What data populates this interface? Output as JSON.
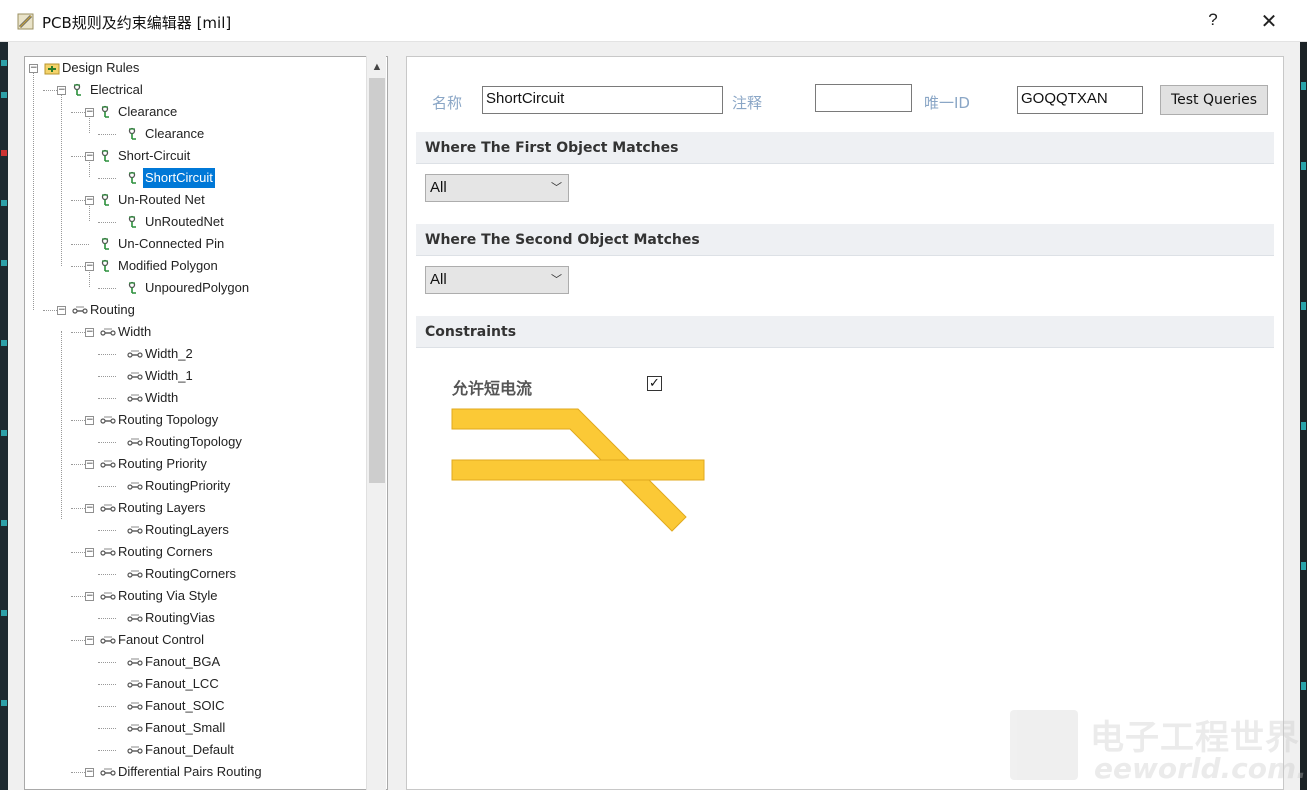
{
  "window": {
    "title": "PCB规则及约束编辑器 [mil]",
    "help_glyph": "?",
    "close_glyph": "✕"
  },
  "tree": {
    "scroll_up_glyph": "▲",
    "nodes": [
      {
        "label": "Design Rules",
        "expander": "−",
        "icon": "design-rules-folder-icon"
      },
      {
        "label": "Electrical",
        "expander": "−",
        "icon": "electrical-rule-icon"
      },
      {
        "label": "Clearance",
        "expander": "−",
        "icon": "electrical-rule-icon"
      },
      {
        "label": "Clearance",
        "expander": "",
        "icon": "electrical-rule-icon"
      },
      {
        "label": "Short-Circuit",
        "expander": "−",
        "icon": "electrical-rule-icon"
      },
      {
        "label": "ShortCircuit",
        "expander": "",
        "icon": "electrical-rule-icon",
        "selected": true
      },
      {
        "label": "Un-Routed Net",
        "expander": "−",
        "icon": "electrical-rule-icon"
      },
      {
        "label": "UnRoutedNet",
        "expander": "",
        "icon": "electrical-rule-icon"
      },
      {
        "label": "Un-Connected Pin",
        "expander": "",
        "icon": "electrical-rule-icon"
      },
      {
        "label": "Modified Polygon",
        "expander": "−",
        "icon": "electrical-rule-icon"
      },
      {
        "label": "UnpouredPolygon",
        "expander": "",
        "icon": "electrical-rule-icon"
      },
      {
        "label": "Routing",
        "expander": "−",
        "icon": "routing-rule-icon"
      },
      {
        "label": "Width",
        "expander": "−",
        "icon": "routing-rule-icon"
      },
      {
        "label": "Width_2",
        "expander": "",
        "icon": "routing-rule-icon"
      },
      {
        "label": "Width_1",
        "expander": "",
        "icon": "routing-rule-icon"
      },
      {
        "label": "Width",
        "expander": "",
        "icon": "routing-rule-icon"
      },
      {
        "label": "Routing Topology",
        "expander": "−",
        "icon": "routing-rule-icon"
      },
      {
        "label": "RoutingTopology",
        "expander": "",
        "icon": "routing-rule-icon"
      },
      {
        "label": "Routing Priority",
        "expander": "−",
        "icon": "routing-rule-icon"
      },
      {
        "label": "RoutingPriority",
        "expander": "",
        "icon": "routing-rule-icon"
      },
      {
        "label": "Routing Layers",
        "expander": "−",
        "icon": "routing-rule-icon"
      },
      {
        "label": "RoutingLayers",
        "expander": "",
        "icon": "routing-rule-icon"
      },
      {
        "label": "Routing Corners",
        "expander": "−",
        "icon": "routing-rule-icon"
      },
      {
        "label": "RoutingCorners",
        "expander": "",
        "icon": "routing-rule-icon"
      },
      {
        "label": "Routing Via Style",
        "expander": "−",
        "icon": "routing-rule-icon"
      },
      {
        "label": "RoutingVias",
        "expander": "",
        "icon": "routing-rule-icon"
      },
      {
        "label": "Fanout Control",
        "expander": "−",
        "icon": "routing-rule-icon"
      },
      {
        "label": "Fanout_BGA",
        "expander": "",
        "icon": "routing-rule-icon"
      },
      {
        "label": "Fanout_LCC",
        "expander": "",
        "icon": "routing-rule-icon"
      },
      {
        "label": "Fanout_SOIC",
        "expander": "",
        "icon": "routing-rule-icon"
      },
      {
        "label": "Fanout_Small",
        "expander": "",
        "icon": "routing-rule-icon"
      },
      {
        "label": "Fanout_Default",
        "expander": "",
        "icon": "routing-rule-icon"
      },
      {
        "label": "Differential Pairs Routing",
        "expander": "−",
        "icon": "routing-rule-icon"
      }
    ]
  },
  "rule": {
    "name_label": "名称",
    "name_value": "ShortCircuit",
    "comment_label": "注释",
    "comment_value": "",
    "uid_label": "唯一ID",
    "uid_value": "GOQQTXAN",
    "test_queries_label": "Test Queries"
  },
  "first_object": {
    "heading": "Where The First Object Matches",
    "selected": "All",
    "chevron": "﹀"
  },
  "second_object": {
    "heading": "Where The Second Object Matches",
    "selected": "All",
    "chevron": "﹀"
  },
  "constraints": {
    "heading": "Constraints",
    "allow_short_label": "允许短电流",
    "allow_short_checked": true,
    "check_glyph": "✓"
  },
  "watermark": {
    "cn": "电子工程世界",
    "en": "eeworld.com.cn"
  },
  "colors": {
    "selection": "#0078d7",
    "trace": "#fbc936",
    "label_blue": "#8aa6c6"
  }
}
